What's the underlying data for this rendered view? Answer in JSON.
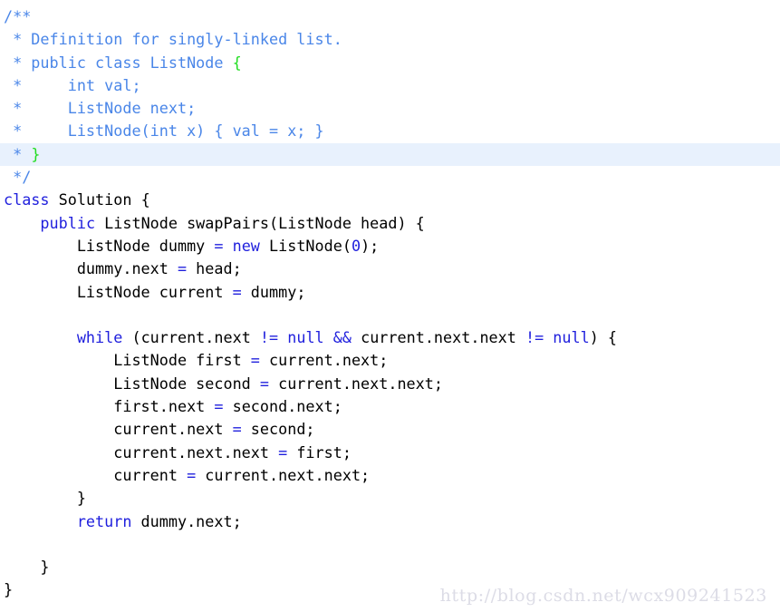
{
  "editor": {
    "language": "java",
    "background_color": "#ffffff",
    "highlight_color": "#e8f1fd",
    "colors": {
      "comment": "#4a86e8",
      "keyword": "#1f1fdd",
      "plain": "#000000",
      "brace_match": "#22dd22",
      "number": "#1f1fdd",
      "operator": "#1f1fdd",
      "watermark": "#dcdce6"
    },
    "highlighted_line_number": 8,
    "lines": [
      {
        "n": 1,
        "highlighted": false,
        "tokens": [
          {
            "t": "/**",
            "c": "comment"
          }
        ]
      },
      {
        "n": 2,
        "highlighted": false,
        "tokens": [
          {
            "t": " * Definition for singly-linked list.",
            "c": "comment"
          }
        ]
      },
      {
        "n": 3,
        "highlighted": false,
        "tokens": [
          {
            "t": " * public class ListNode ",
            "c": "comment"
          },
          {
            "t": "{",
            "c": "brace-match"
          }
        ]
      },
      {
        "n": 4,
        "highlighted": false,
        "tokens": [
          {
            "t": " *     int val;",
            "c": "comment"
          }
        ]
      },
      {
        "n": 5,
        "highlighted": false,
        "tokens": [
          {
            "t": " *     ListNode next;",
            "c": "comment"
          }
        ]
      },
      {
        "n": 6,
        "highlighted": false,
        "tokens": [
          {
            "t": " *     ListNode(int x) { val = x; }",
            "c": "comment"
          }
        ]
      },
      {
        "n": 7,
        "highlighted": true,
        "tokens": [
          {
            "t": " * ",
            "c": "comment"
          },
          {
            "t": "}",
            "c": "brace-match"
          }
        ]
      },
      {
        "n": 8,
        "highlighted": false,
        "tokens": [
          {
            "t": " */",
            "c": "comment"
          }
        ]
      },
      {
        "n": 9,
        "highlighted": false,
        "tokens": [
          {
            "t": "class",
            "c": "keyword"
          },
          {
            "t": " Solution {",
            "c": "plain"
          }
        ]
      },
      {
        "n": 10,
        "highlighted": false,
        "tokens": [
          {
            "t": "    ",
            "c": "plain"
          },
          {
            "t": "public",
            "c": "keyword"
          },
          {
            "t": " ListNode swapPairs(ListNode head) {",
            "c": "plain"
          }
        ]
      },
      {
        "n": 11,
        "highlighted": false,
        "tokens": [
          {
            "t": "        ListNode dummy ",
            "c": "plain"
          },
          {
            "t": "=",
            "c": "operator"
          },
          {
            "t": " ",
            "c": "plain"
          },
          {
            "t": "new",
            "c": "keyword"
          },
          {
            "t": " ListNode(",
            "c": "plain"
          },
          {
            "t": "0",
            "c": "number"
          },
          {
            "t": ");",
            "c": "plain"
          }
        ]
      },
      {
        "n": 12,
        "highlighted": false,
        "tokens": [
          {
            "t": "        dummy.next ",
            "c": "plain"
          },
          {
            "t": "=",
            "c": "operator"
          },
          {
            "t": " head;",
            "c": "plain"
          }
        ]
      },
      {
        "n": 13,
        "highlighted": false,
        "tokens": [
          {
            "t": "        ListNode current ",
            "c": "plain"
          },
          {
            "t": "=",
            "c": "operator"
          },
          {
            "t": " dummy;",
            "c": "plain"
          }
        ]
      },
      {
        "n": 14,
        "highlighted": false,
        "tokens": []
      },
      {
        "n": 15,
        "highlighted": false,
        "tokens": [
          {
            "t": "        ",
            "c": "plain"
          },
          {
            "t": "while",
            "c": "keyword"
          },
          {
            "t": " (current.next ",
            "c": "plain"
          },
          {
            "t": "!=",
            "c": "operator"
          },
          {
            "t": " ",
            "c": "plain"
          },
          {
            "t": "null",
            "c": "keyword"
          },
          {
            "t": " ",
            "c": "plain"
          },
          {
            "t": "&&",
            "c": "operator"
          },
          {
            "t": " current.next.next ",
            "c": "plain"
          },
          {
            "t": "!=",
            "c": "operator"
          },
          {
            "t": " ",
            "c": "plain"
          },
          {
            "t": "null",
            "c": "keyword"
          },
          {
            "t": ") {",
            "c": "plain"
          }
        ]
      },
      {
        "n": 16,
        "highlighted": false,
        "tokens": [
          {
            "t": "            ListNode first ",
            "c": "plain"
          },
          {
            "t": "=",
            "c": "operator"
          },
          {
            "t": " current.next;",
            "c": "plain"
          }
        ]
      },
      {
        "n": 17,
        "highlighted": false,
        "tokens": [
          {
            "t": "            ListNode second ",
            "c": "plain"
          },
          {
            "t": "=",
            "c": "operator"
          },
          {
            "t": " current.next.next;",
            "c": "plain"
          }
        ]
      },
      {
        "n": 18,
        "highlighted": false,
        "tokens": [
          {
            "t": "            first.next ",
            "c": "plain"
          },
          {
            "t": "=",
            "c": "operator"
          },
          {
            "t": " second.next;",
            "c": "plain"
          }
        ]
      },
      {
        "n": 19,
        "highlighted": false,
        "tokens": [
          {
            "t": "            current.next ",
            "c": "plain"
          },
          {
            "t": "=",
            "c": "operator"
          },
          {
            "t": " second;",
            "c": "plain"
          }
        ]
      },
      {
        "n": 20,
        "highlighted": false,
        "tokens": [
          {
            "t": "            current.next.next ",
            "c": "plain"
          },
          {
            "t": "=",
            "c": "operator"
          },
          {
            "t": " first;",
            "c": "plain"
          }
        ]
      },
      {
        "n": 21,
        "highlighted": false,
        "tokens": [
          {
            "t": "            current ",
            "c": "plain"
          },
          {
            "t": "=",
            "c": "operator"
          },
          {
            "t": " current.next.next;",
            "c": "plain"
          }
        ]
      },
      {
        "n": 22,
        "highlighted": false,
        "tokens": [
          {
            "t": "        }",
            "c": "plain"
          }
        ]
      },
      {
        "n": 23,
        "highlighted": false,
        "tokens": [
          {
            "t": "        ",
            "c": "plain"
          },
          {
            "t": "return",
            "c": "keyword"
          },
          {
            "t": " dummy.next;",
            "c": "plain"
          }
        ]
      },
      {
        "n": 24,
        "highlighted": false,
        "tokens": []
      },
      {
        "n": 25,
        "highlighted": false,
        "tokens": [
          {
            "t": "    }",
            "c": "plain"
          }
        ]
      },
      {
        "n": 26,
        "highlighted": false,
        "tokens": [
          {
            "t": "}",
            "c": "plain"
          }
        ]
      }
    ]
  },
  "watermark": {
    "text": "http://blog.csdn.net/wcx909241523"
  }
}
